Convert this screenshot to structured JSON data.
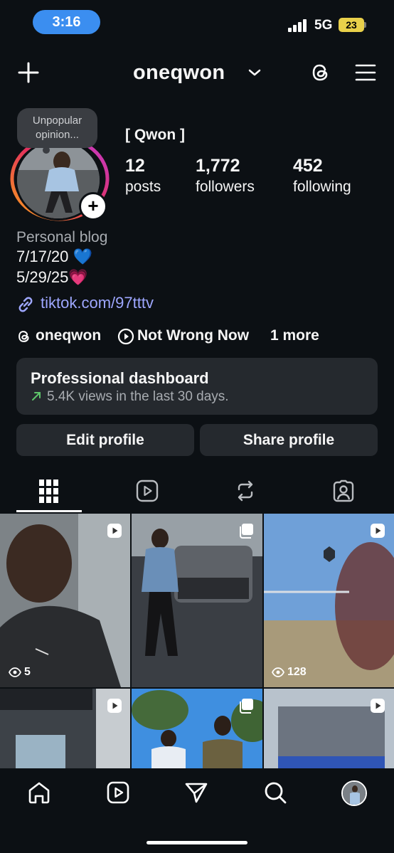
{
  "status_bar": {
    "time": "3:16",
    "network": "5G",
    "battery": "23"
  },
  "header": {
    "username": "oneqwon"
  },
  "profile": {
    "note": "Unpopular opinion...",
    "display_name": "[ Qwon ]",
    "stats": [
      {
        "value": "12",
        "label": "posts"
      },
      {
        "value": "1,772",
        "label": "followers"
      },
      {
        "value": "452",
        "label": "following"
      }
    ],
    "category": "Personal blog",
    "bio_lines": [
      "7/17/20 💙",
      "5/29/25💗"
    ],
    "link": "tiktok.com/97tttv",
    "threads_handle": "oneqwon",
    "music": "Not Wrong Now",
    "more": "1 more"
  },
  "dashboard": {
    "title": "Professional dashboard",
    "subtitle": "5.4K views in the last 30 days."
  },
  "buttons": {
    "edit": "Edit profile",
    "share": "Share profile"
  },
  "tabs": [
    "grid-icon",
    "reels-icon",
    "reposts-icon",
    "tagged-icon"
  ],
  "grid": [
    {
      "type": "reel",
      "views": "5"
    },
    {
      "type": "carousel",
      "views": ""
    },
    {
      "type": "reel",
      "views": "128"
    },
    {
      "type": "reel",
      "views": ""
    },
    {
      "type": "carousel",
      "views": ""
    },
    {
      "type": "reel",
      "views": ""
    }
  ],
  "colors": {
    "background": "#0c1014",
    "surface": "#25292e",
    "link": "#9ea7ff",
    "status_pill": "#3b8ef0",
    "battery": "#e9d04a"
  }
}
